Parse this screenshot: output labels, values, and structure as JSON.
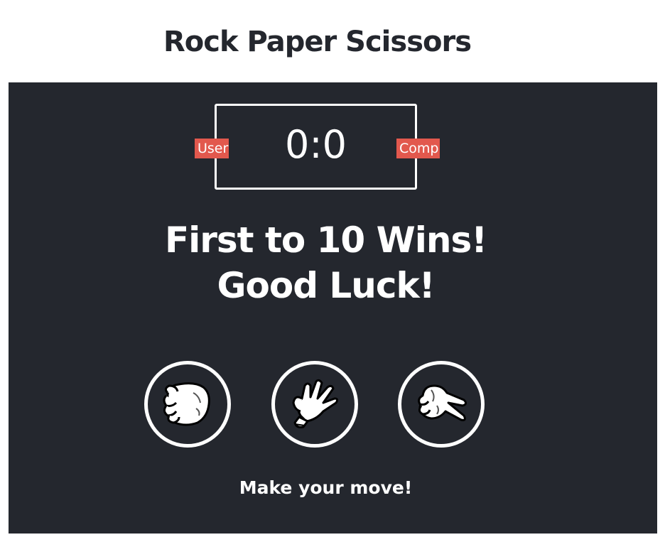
{
  "header": {
    "title": "Rock Paper Scissors"
  },
  "scoreboard": {
    "score": "0:0",
    "user_label": "User",
    "comp_label": "Comp"
  },
  "result": {
    "line1": "First to 10 Wins!",
    "line2": "Good Luck!"
  },
  "choices": [
    {
      "name": "rock",
      "icon": "rock-hand-icon"
    },
    {
      "name": "paper",
      "icon": "paper-hand-icon"
    },
    {
      "name": "scissors",
      "icon": "scissors-hand-icon"
    }
  ],
  "action_message": "Make your move!",
  "colors": {
    "background": "#24272e",
    "badge": "#e2584d",
    "text": "#ffffff"
  }
}
